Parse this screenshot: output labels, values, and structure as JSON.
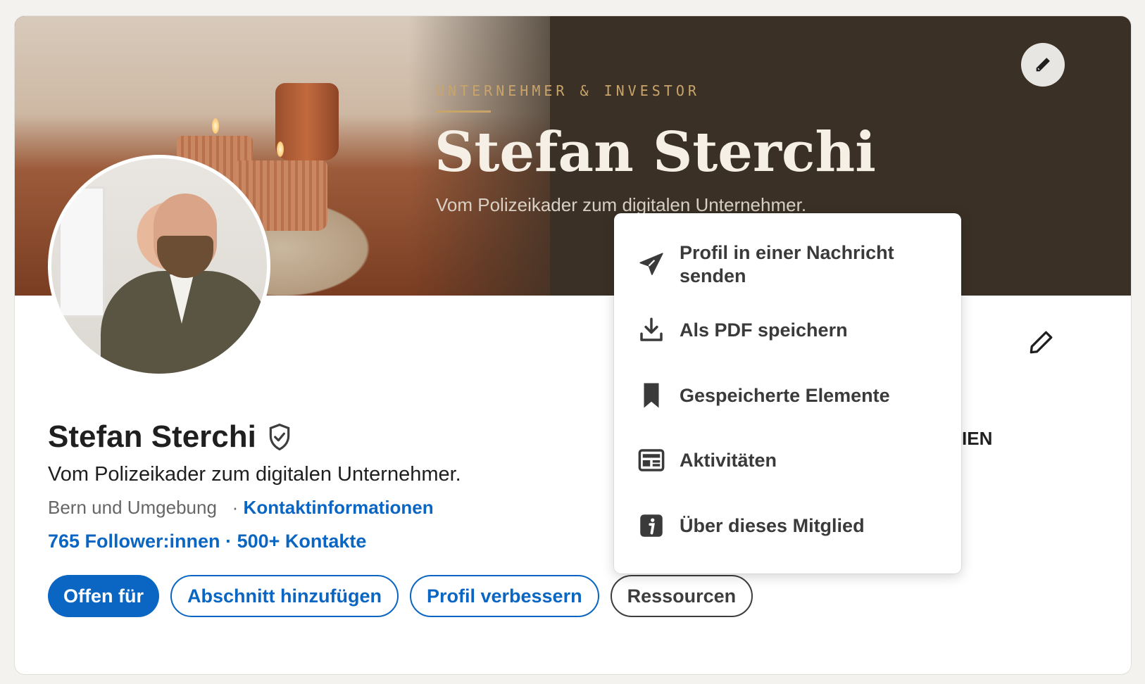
{
  "banner": {
    "kicker": "UNTERNEHMER & INVESTOR",
    "name": "Stefan Sterchi",
    "tagline": "Vom Polizeikader zum digitalen Unternehmer."
  },
  "profile": {
    "name": "Stefan Sterchi",
    "headline": "Vom Polizeikader zum digitalen Unternehmer.",
    "location": "Bern und Umgebung",
    "separator": "·",
    "contact_link": "Kontaktinformationen",
    "followers": "765 Follower:innen",
    "connections": "500+ Kontakte",
    "truncated_text": "IEN"
  },
  "actions": {
    "open_to": "Offen für",
    "add_section": "Abschnitt hinzufügen",
    "improve_profile": "Profil verbessern",
    "resources": "Ressourcen"
  },
  "menu": {
    "items": [
      {
        "label": "Profil in einer Nachricht senden",
        "icon": "send-icon"
      },
      {
        "label": "Als PDF speichern",
        "icon": "download-icon"
      },
      {
        "label": "Gespeicherte Elemente",
        "icon": "bookmark-icon"
      },
      {
        "label": "Aktivitäten",
        "icon": "activity-icon"
      },
      {
        "label": "Über dieses Mitglied",
        "icon": "info-icon"
      }
    ]
  },
  "colors": {
    "accent": "#0a66c2",
    "banner_bg": "#3a3026",
    "banner_gold": "#c9a46a",
    "page_bg": "#f4f2ee"
  }
}
